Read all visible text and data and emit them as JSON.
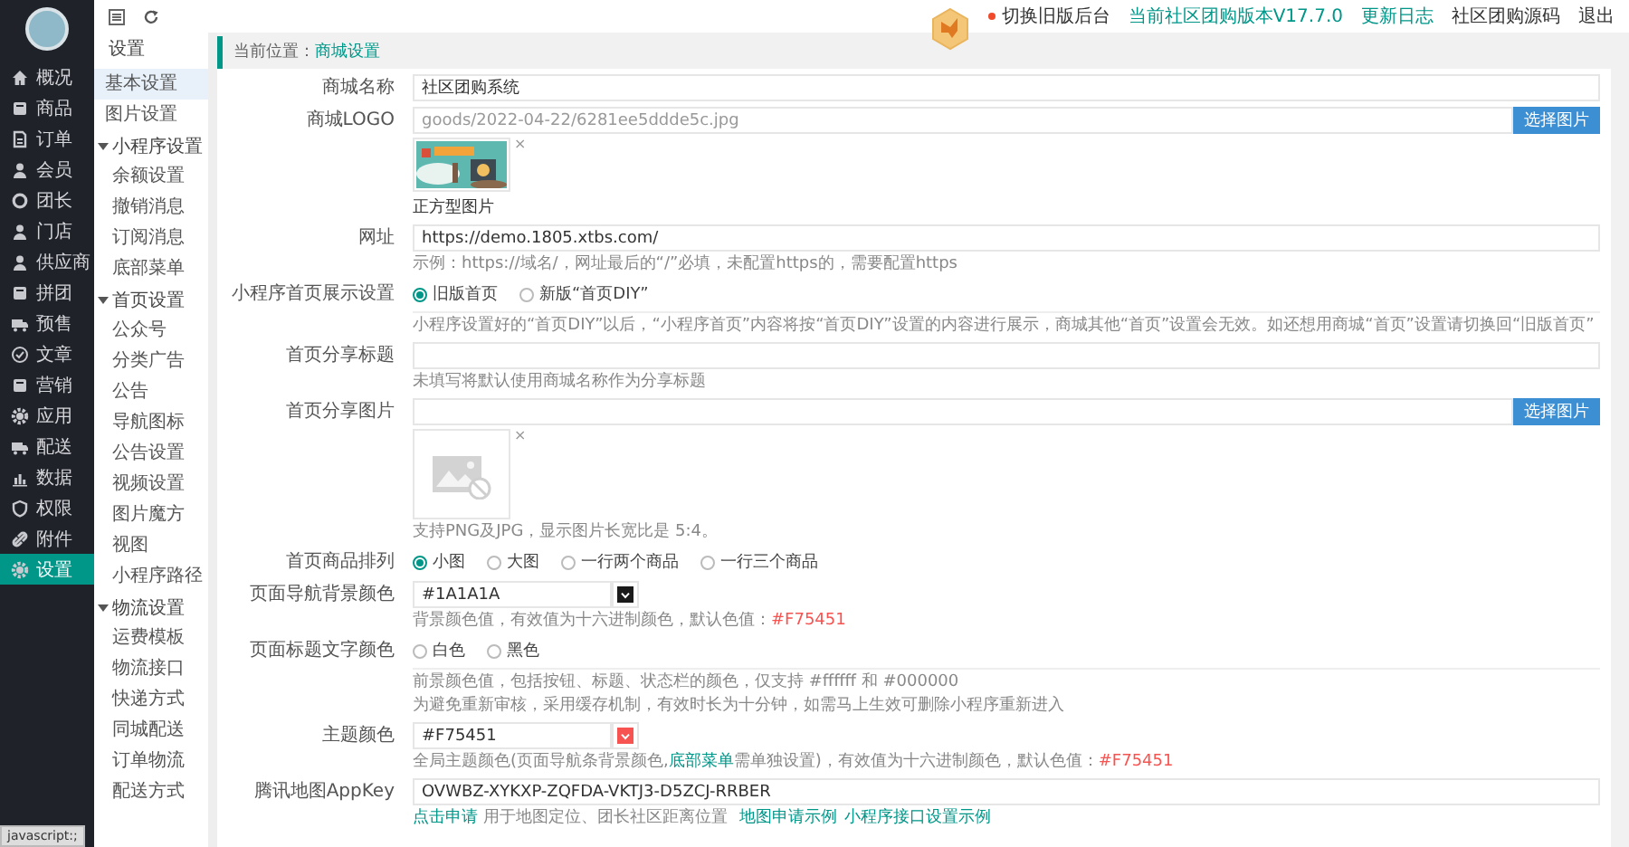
{
  "nav": {
    "items": [
      {
        "label": "概况",
        "selected": false
      },
      {
        "label": "商品",
        "selected": false
      },
      {
        "label": "订单",
        "selected": false
      },
      {
        "label": "会员",
        "selected": false
      },
      {
        "label": "团长",
        "selected": false
      },
      {
        "label": "门店",
        "selected": false
      },
      {
        "label": "供应商",
        "selected": false
      },
      {
        "label": "拼团",
        "selected": false
      },
      {
        "label": "预售",
        "selected": false
      },
      {
        "label": "文章",
        "selected": false
      },
      {
        "label": "营销",
        "selected": false
      },
      {
        "label": "应用",
        "selected": false
      },
      {
        "label": "配送",
        "selected": false
      },
      {
        "label": "数据",
        "selected": false
      },
      {
        "label": "权限",
        "selected": false
      },
      {
        "label": "附件",
        "selected": false
      },
      {
        "label": "设置",
        "selected": true
      }
    ]
  },
  "sub_menu": {
    "title": "设置",
    "items": [
      {
        "label": "基本设置",
        "selected": true
      },
      {
        "label": "图片设置",
        "selected": false
      },
      {
        "label": "小程序设置",
        "expanded": true,
        "children": [
          {
            "label": "余额设置",
            "selected": false
          },
          {
            "label": "撤销消息",
            "selected": false
          },
          {
            "label": "订阅消息",
            "selected": false
          },
          {
            "label": "底部菜单",
            "selected": false
          }
        ]
      },
      {
        "label": "首页设置",
        "expanded": true,
        "children": [
          {
            "label": "公众号",
            "selected": false
          },
          {
            "label": "分类广告",
            "selected": false
          },
          {
            "label": "公告",
            "selected": false
          },
          {
            "label": "导航图标",
            "selected": false
          },
          {
            "label": "公告设置",
            "selected": false
          },
          {
            "label": "视频设置",
            "selected": false
          },
          {
            "label": "图片魔方",
            "selected": false
          },
          {
            "label": "视图",
            "selected": false
          },
          {
            "label": "小程序路径",
            "selected": false
          }
        ]
      },
      {
        "label": "物流设置",
        "expanded": true,
        "children": [
          {
            "label": "运费模板",
            "selected": false
          },
          {
            "label": "物流接口",
            "selected": false
          },
          {
            "label": "快递方式",
            "selected": false
          },
          {
            "label": "同城配送",
            "selected": false
          },
          {
            "label": "订单物流",
            "selected": false
          },
          {
            "label": "配送方式",
            "selected": false
          }
        ]
      }
    ]
  },
  "top_bar": {
    "links": [
      {
        "label": "切换旧版后台",
        "kind": "alert"
      },
      {
        "label": "当前社区团购版本V17.7.0",
        "kind": "accent"
      },
      {
        "label": "更新日志",
        "kind": "accent"
      },
      {
        "label": "社区团购源码",
        "kind": "plain"
      },
      {
        "label": "退出",
        "kind": "plain"
      }
    ]
  },
  "breadcrumb": {
    "prefix": "当前位置：",
    "current": "商城设置"
  },
  "form": {
    "rows": [
      {
        "kind": "text",
        "label": "商城名称",
        "value": "社区团购系统"
      },
      {
        "kind": "text",
        "label": "商城LOGO",
        "placeholder": "goods/2022-04-22/6281ee5ddde5c.jpg",
        "button": "选择图片",
        "remove": "×",
        "caption": "正方型图片"
      },
      {
        "kind": "text",
        "label": "网址",
        "value": "https://demo.1805.xtbs.com/",
        "hints": [
          [
            {
              "text": "示例：https://域名/，网址最后的“/”必填，未配置https的，需要配置https",
              "kind": "plain"
            }
          ]
        ]
      },
      {
        "kind": "radio",
        "label": "小程序首页展示设置",
        "options": [
          {
            "label": "旧版首页",
            "selected": true
          },
          {
            "label": "新版“首页DIY”",
            "selected": false
          }
        ],
        "hints": [
          [
            {
              "text": "小程序设置好的“首页DIY”以后，“小程序首页”内容将按“首页DIY”设置的内容进行展示，商城其他“首页”设置会无效。如还想用商城“首页”设置请切换回“旧版首页”",
              "kind": "plain"
            }
          ]
        ]
      },
      {
        "kind": "text",
        "label": "首页分享标题",
        "hints": [
          [
            {
              "text": "未填写将默认使用商城名称作为分享标题",
              "kind": "plain"
            }
          ]
        ]
      },
      {
        "kind": "text",
        "label": "首页分享图片",
        "button": "选择图片",
        "preview": {
          "kind": "empty"
        },
        "remove": "×",
        "hints": [
          [
            {
              "text": "支持PNG及JPG，显示图片长宽比是 5:4。",
              "kind": "plain"
            }
          ]
        ]
      },
      {
        "kind": "radio",
        "label": "首页商品排列",
        "options": [
          {
            "label": "小图",
            "selected": true
          },
          {
            "label": "大图",
            "selected": false
          },
          {
            "label": "一行两个商品",
            "selected": false
          },
          {
            "label": "一行三个商品",
            "selected": false
          }
        ]
      },
      {
        "kind": "color",
        "label": "页面导航背景颜色",
        "value": "#1A1A1A",
        "color": "#1a1a1a",
        "hints": [
          [
            {
              "text": "背景颜色值，有效值为十六进制颜色，默认色值：",
              "kind": "plain"
            },
            {
              "text": "#F75451",
              "kind": "accent"
            }
          ]
        ]
      },
      {
        "kind": "radio",
        "label": "页面标题文字颜色",
        "options": [
          {
            "label": "白色",
            "selected": false
          },
          {
            "label": "黑色",
            "selected": false
          }
        ],
        "hints": [
          [
            {
              "text": "前景颜色值，包括按钮、标题、状态栏的颜色，仅支持 #ffffff 和 #000000",
              "kind": "plain"
            }
          ],
          [
            {
              "text": "为避免重新审核，采用缓存机制，有效时长为十分钟，如需马上生效可删除小程序重新进入",
              "kind": "plain"
            }
          ]
        ]
      },
      {
        "kind": "color",
        "label": "主题颜色",
        "value": "#F75451",
        "color": "#f75451",
        "hints": [
          [
            {
              "text": "全局主题颜色(页面导航条背景颜色,",
              "kind": "plain"
            },
            {
              "text": "底部菜单",
              "kind": "link"
            },
            {
              "text": "需单独设置)，有效值为十六进制颜色，默认色值：",
              "kind": "plain"
            },
            {
              "text": "#F75451",
              "kind": "accent"
            }
          ]
        ]
      },
      {
        "kind": "text",
        "label": "腾讯地图AppKey",
        "value": "OVWBZ-XYKXP-ZQFDA-VKTJ3-D5ZCJ-RRBER",
        "hints": [
          [
            {
              "text": "点击申请",
              "kind": "link"
            },
            {
              "text": " 用于地图定位、团长社区距离位置 ",
              "kind": "plain"
            },
            {
              "text": "地图申请示例",
              "kind": "link"
            },
            {
              "text": "小程序接口设置示例",
              "kind": "link"
            }
          ]
        ]
      }
    ]
  },
  "status_tip": "javascript:;"
}
